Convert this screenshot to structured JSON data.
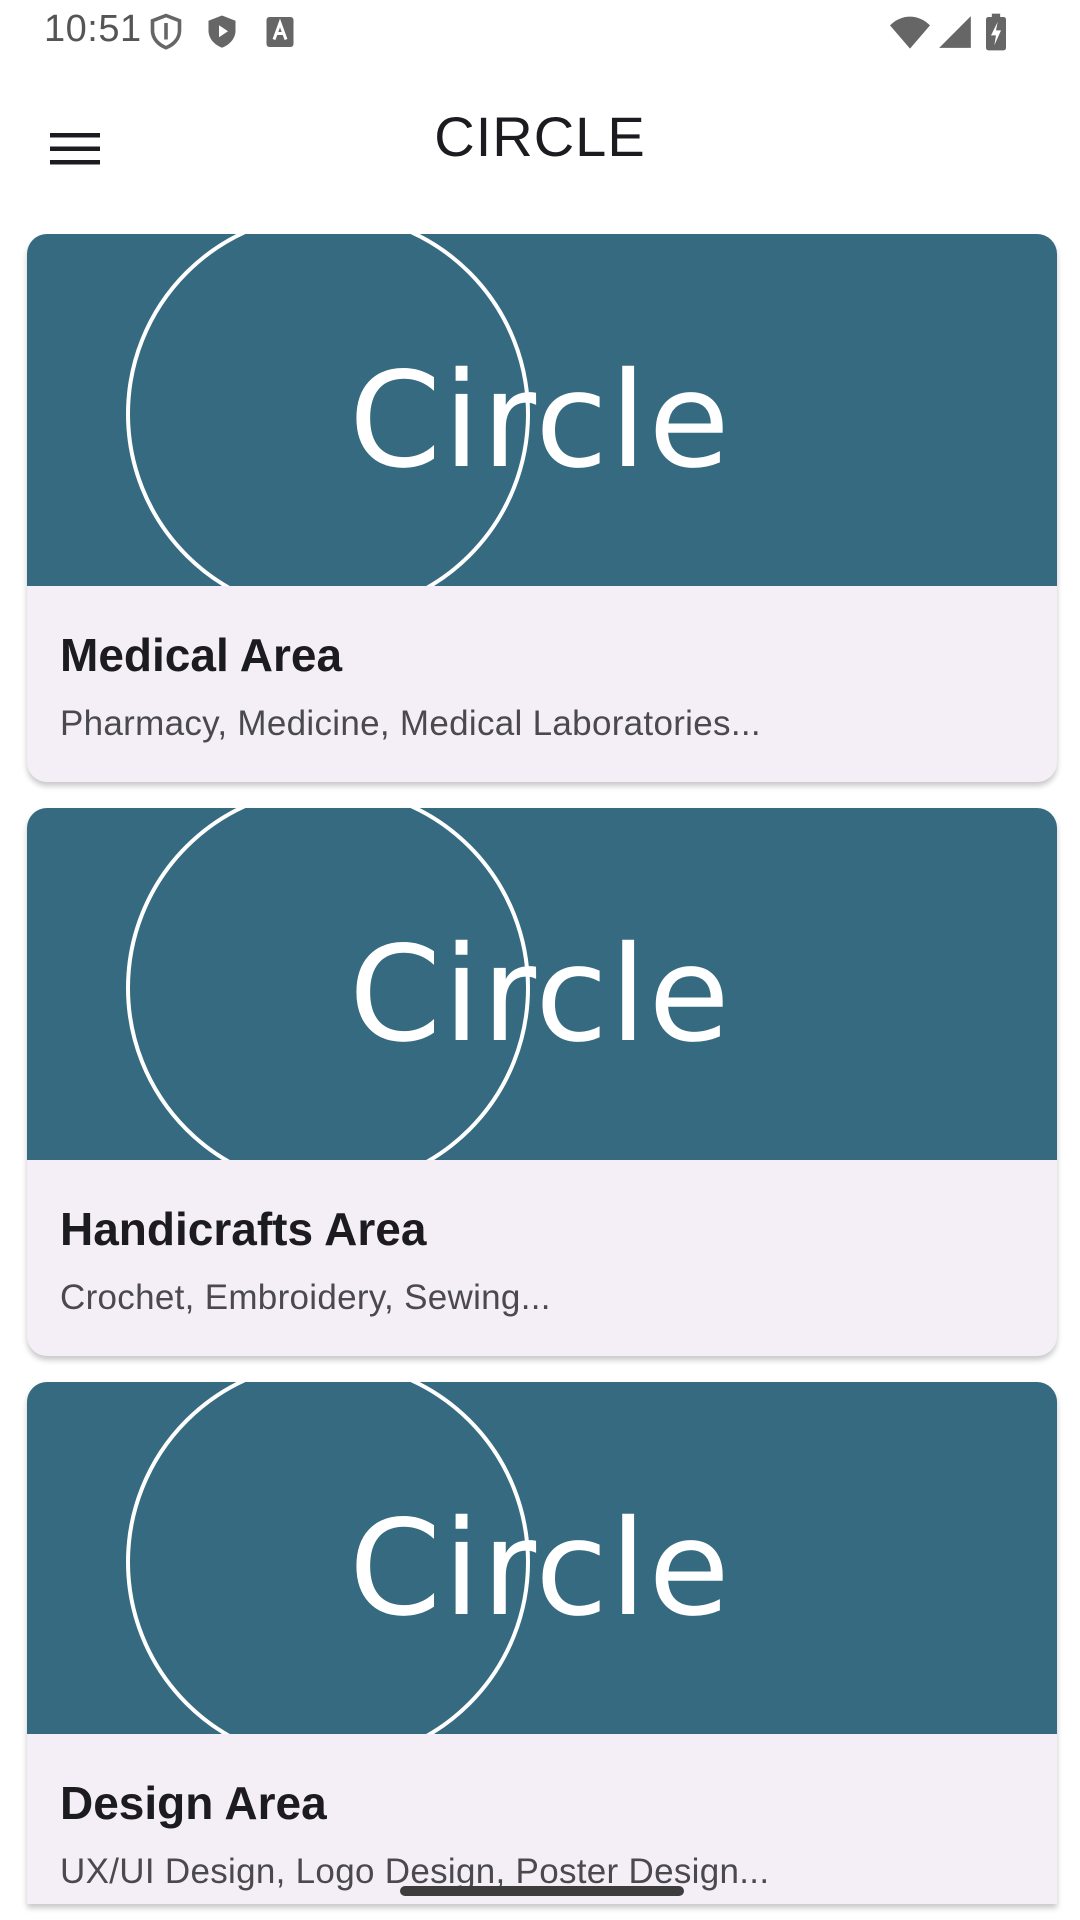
{
  "status_bar": {
    "time": "10:51",
    "icons_left": [
      "shield-outline-icon",
      "shield-play-icon",
      "font-a-icon"
    ],
    "icons_right": [
      "wifi-icon",
      "signal-icon",
      "battery-charging-icon"
    ]
  },
  "app_bar": {
    "title": "CIRCLE",
    "menu_icon": "hamburger-menu-icon"
  },
  "cards": [
    {
      "image_logo_text": "Circle",
      "title": "Medical Area",
      "subtitle": "Pharmacy, Medicine, Medical Laboratories..."
    },
    {
      "image_logo_text": "Circle",
      "title": "Handicrafts Area",
      "subtitle": "Crochet, Embroidery, Sewing..."
    },
    {
      "image_logo_text": "Circle",
      "title": "Design Area",
      "subtitle": "UX/UI Design, Logo Design, Poster Design..."
    }
  ],
  "colors": {
    "card_image_bg": "#356a80",
    "card_bg": "#f4eff7",
    "logo": "#ffffff"
  }
}
